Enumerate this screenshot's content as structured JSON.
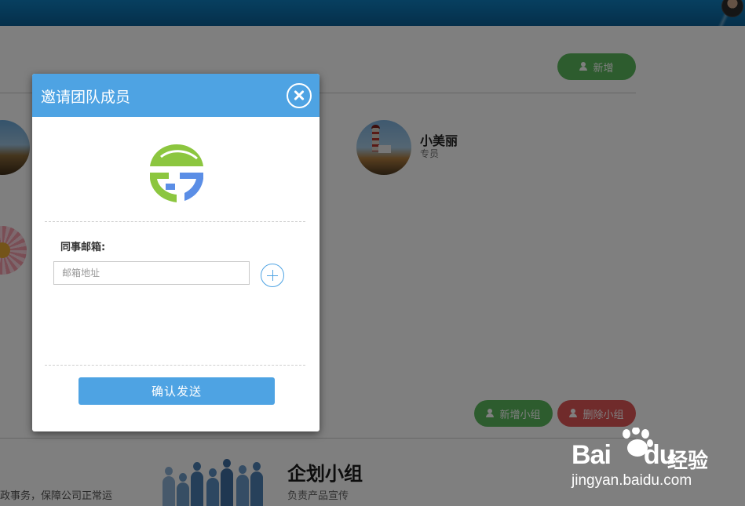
{
  "background": {
    "buttons": {
      "add_label": "新增",
      "add_group_label": "新增小组",
      "delete_group_label": "删除小组"
    },
    "member": {
      "name": "小美丽",
      "role": "专员"
    },
    "group": {
      "title": "企划小组",
      "desc": "负责产品宣传"
    },
    "left_desc": "政事务，保障公司正常运"
  },
  "modal": {
    "title": "邀请团队成员",
    "field_label": "同事邮箱:",
    "email_placeholder": "邮箱地址",
    "email_value": "",
    "submit_label": "确认发送"
  },
  "watermark": {
    "brand_left": "Bai",
    "brand_right": "du",
    "cn": "经验",
    "url": "jingyan.baidu.com"
  },
  "colors": {
    "accent": "#4ea3e3",
    "green": "#5bb85d",
    "red": "#e05757",
    "topbar": "#0a6aa8",
    "logo_green": "#8cc63f",
    "logo_blue": "#5b8ee6"
  },
  "icons": [
    "user-add-icon",
    "user-delete-icon",
    "close-icon",
    "plus-icon",
    "logo-icon"
  ]
}
